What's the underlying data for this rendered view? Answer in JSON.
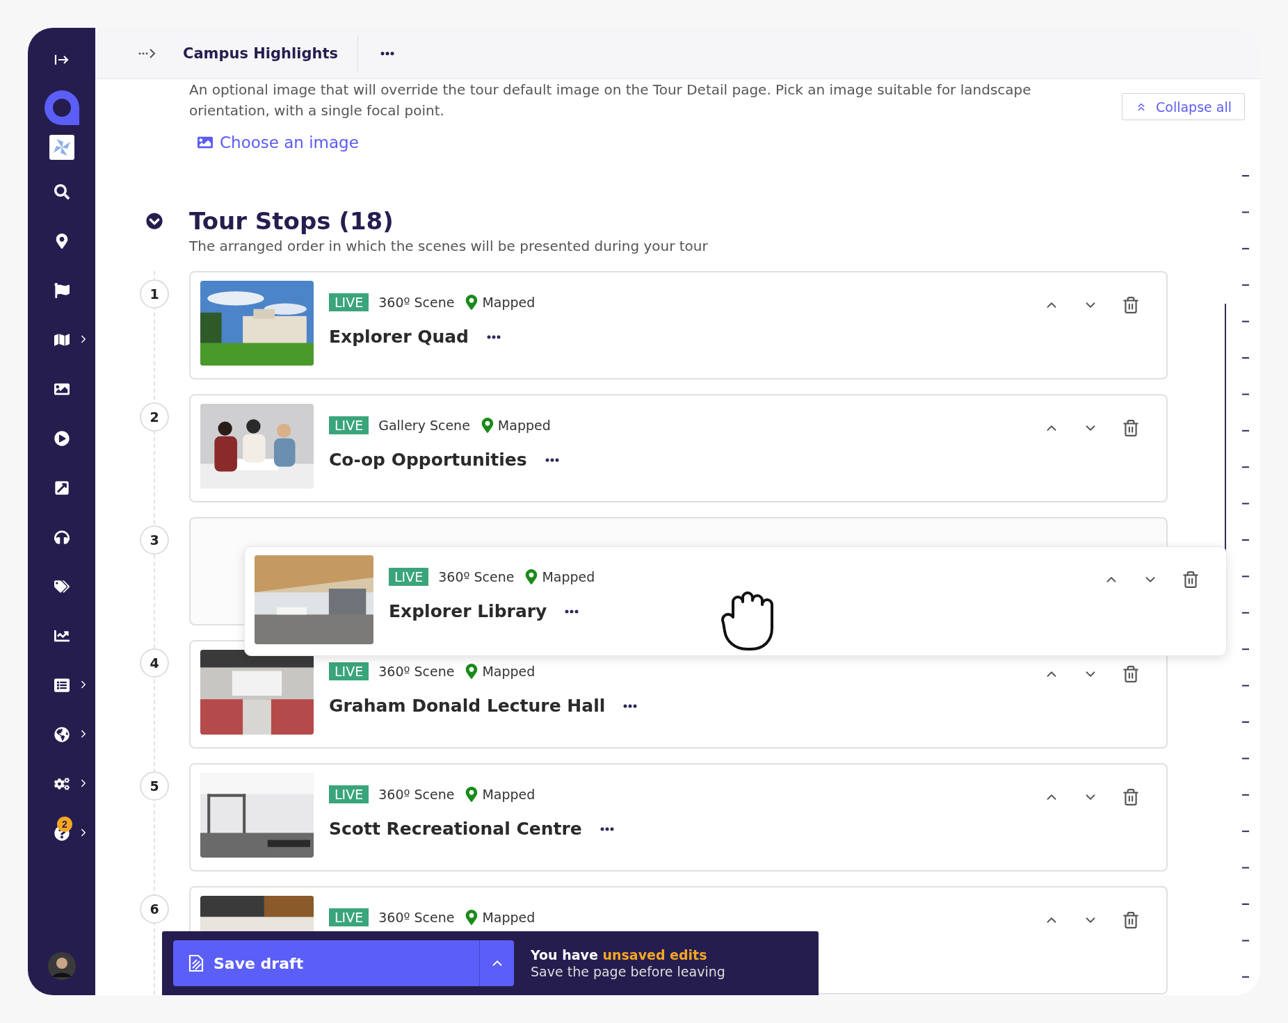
{
  "sidebar": {
    "items": [
      {
        "expandable": false
      },
      {
        "expandable": false
      },
      {
        "expandable": false
      },
      {
        "expandable": true
      },
      {
        "expandable": false
      },
      {
        "expandable": false
      },
      {
        "expandable": false
      },
      {
        "expandable": false
      },
      {
        "expandable": false
      },
      {
        "expandable": false
      },
      {
        "expandable": true
      },
      {
        "expandable": true
      },
      {
        "expandable": true
      },
      {
        "expandable": true,
        "badge": "2"
      }
    ]
  },
  "header": {
    "title": "Campus Highlights"
  },
  "image_field": {
    "description": "An optional image that will override the tour default image on the Tour Detail page. Pick an image suitable for landscape orientation, with a single focal point.",
    "link": "Choose an image"
  },
  "collapse_button": "Collapse all",
  "tour_stops": {
    "title": "Tour Stops (18)",
    "subtitle": "The arranged order in which the scenes will be presented during your tour",
    "expanded": true,
    "stops": [
      {
        "number": "1",
        "status": "LIVE",
        "scene_type": "360º Scene",
        "map_status": "Mapped",
        "title": "Explorer Quad",
        "dragging": false
      },
      {
        "number": "2",
        "status": "LIVE",
        "scene_type": "Gallery Scene",
        "map_status": "Mapped",
        "title": "Co-op Opportunities",
        "dragging": false
      },
      {
        "number": "3",
        "status": "LIVE",
        "scene_type": "360º Scene",
        "map_status": "Mapped",
        "title": "Explorer Library",
        "dragging": true
      },
      {
        "number": "4",
        "status": "LIVE",
        "scene_type": "360º Scene",
        "map_status": "Mapped",
        "title": "Graham Donald Lecture Hall",
        "dragging": false
      },
      {
        "number": "5",
        "status": "LIVE",
        "scene_type": "360º Scene",
        "map_status": "Mapped",
        "title": "Scott Recreational Centre",
        "dragging": false
      },
      {
        "number": "6",
        "status": "LIVE",
        "scene_type": "360º Scene",
        "map_status": "Mapped",
        "dragging": false
      }
    ]
  },
  "save_bar": {
    "button": "Save draft",
    "message_start": "You have",
    "message_highlight": "unsaved edits",
    "hint": "Save the page before leaving"
  }
}
